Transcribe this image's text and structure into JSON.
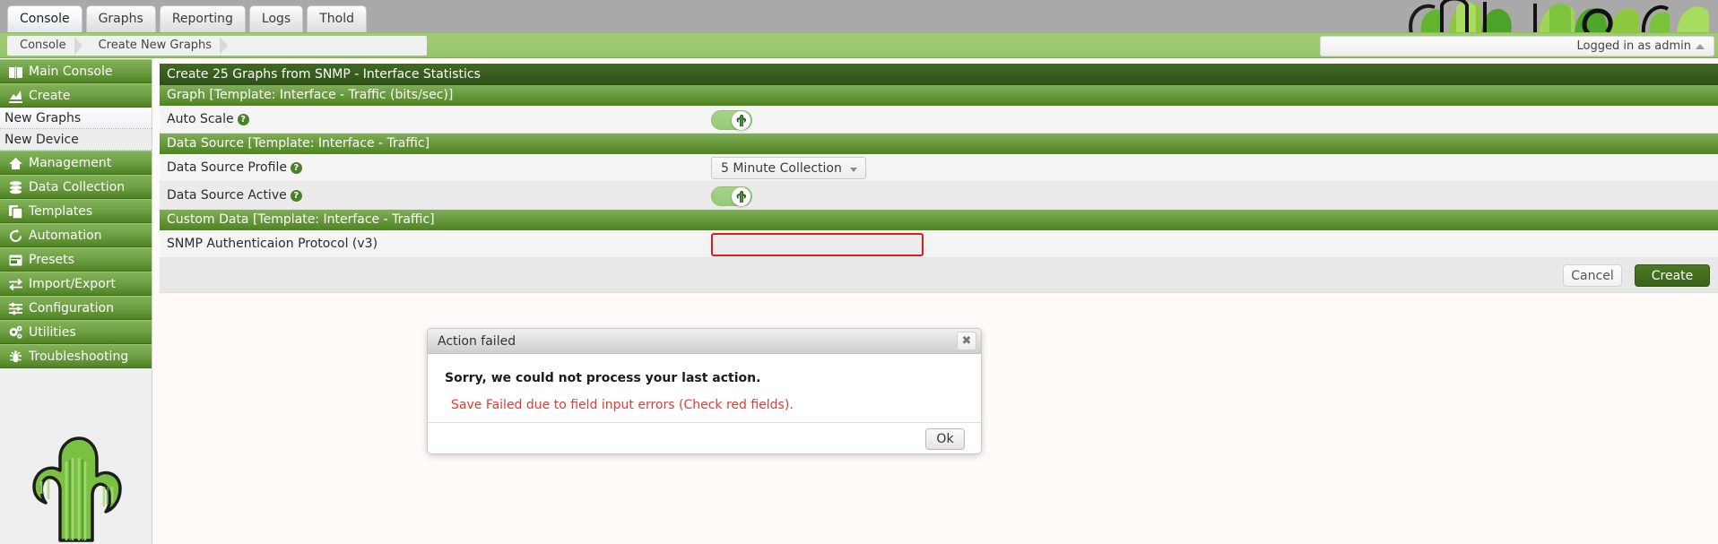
{
  "topbar": {
    "tabs": [
      {
        "label": "Console",
        "selected": true
      },
      {
        "label": "Graphs",
        "selected": false
      },
      {
        "label": "Reporting",
        "selected": false
      },
      {
        "label": "Logs",
        "selected": false
      },
      {
        "label": "Thold",
        "selected": false
      }
    ]
  },
  "breadcrumb": {
    "crumbs": [
      {
        "label": "Console"
      },
      {
        "label": "Create New Graphs"
      }
    ],
    "login_label": "Logged in as admin"
  },
  "sidebar": {
    "items": [
      {
        "label": "Main Console",
        "icon": "book-icon",
        "type": "nav"
      },
      {
        "label": "Create",
        "icon": "chart-icon",
        "type": "nav"
      },
      {
        "label": "New Graphs",
        "icon": "",
        "type": "sub",
        "current": true
      },
      {
        "label": "New Device",
        "icon": "",
        "type": "sub",
        "current": false
      },
      {
        "label": "Management",
        "icon": "home-icon",
        "type": "nav"
      },
      {
        "label": "Data Collection",
        "icon": "database-icon",
        "type": "nav"
      },
      {
        "label": "Templates",
        "icon": "copy-icon",
        "type": "nav"
      },
      {
        "label": "Automation",
        "icon": "refresh-icon",
        "type": "nav"
      },
      {
        "label": "Presets",
        "icon": "window-icon",
        "type": "nav"
      },
      {
        "label": "Import/Export",
        "icon": "exchange-icon",
        "type": "nav"
      },
      {
        "label": "Configuration",
        "icon": "sliders-icon",
        "type": "nav"
      },
      {
        "label": "Utilities",
        "icon": "gears-icon",
        "type": "nav"
      },
      {
        "label": "Troubleshooting",
        "icon": "bug-icon",
        "type": "nav"
      }
    ]
  },
  "main": {
    "page_title": "Create 25 Graphs from SNMP - Interface Statistics",
    "sections": [
      {
        "header": "Graph [Template: Interface - Traffic (bits/sec)]",
        "rows": [
          {
            "label": "Auto Scale",
            "help": "?",
            "control": "toggle",
            "value": "on"
          }
        ]
      },
      {
        "header": "Data Source [Template: Interface - Traffic]",
        "rows": [
          {
            "label": "Data Source Profile",
            "help": "?",
            "control": "select",
            "value": "5 Minute Collection"
          },
          {
            "label": "Data Source Active",
            "help": "?",
            "control": "toggle",
            "value": "on"
          }
        ]
      },
      {
        "header": "Custom Data [Template: Interface - Traffic]",
        "rows": [
          {
            "label": "SNMP Authenticaion Protocol (v3)",
            "help": "",
            "control": "text",
            "value": "",
            "placeholder": "",
            "error": true
          }
        ]
      }
    ],
    "actions": {
      "cancel_label": "Cancel",
      "create_label": "Create"
    }
  },
  "modal": {
    "title": "Action failed",
    "close_label": "✖",
    "message_main": "Sorry, we could not process your last action.",
    "message_error": "Save Failed due to field input errors (Check red fields).",
    "ok_label": "Ok"
  },
  "colors": {
    "brand_green": "#4e8321",
    "section_green": "#7fae57",
    "title_green": "#3f6a23",
    "error_red": "#e01b1b",
    "error_text": "#e23b30",
    "topbar_gray": "#a9a9a9",
    "breadcrumb_green": "#97c46c",
    "page_bg": "#fffaf7"
  }
}
